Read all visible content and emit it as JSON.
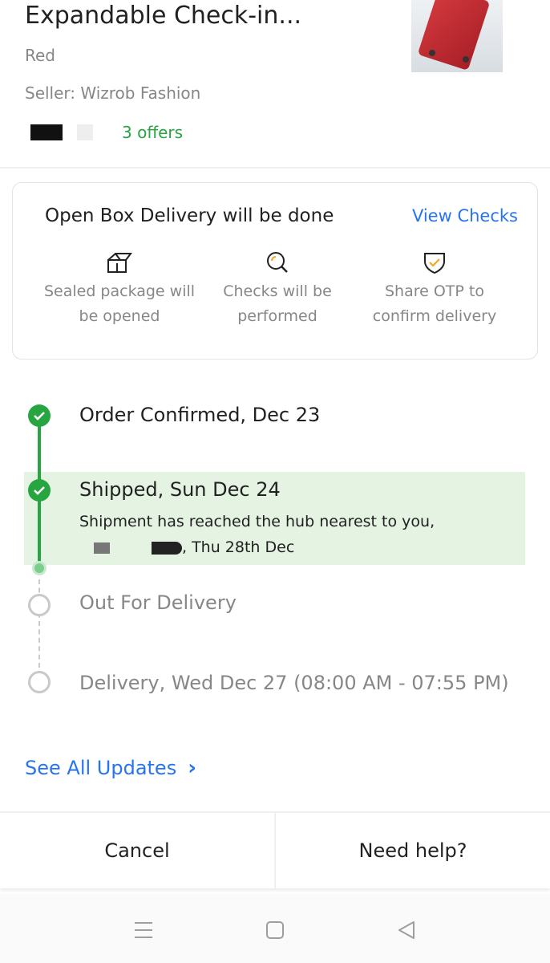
{
  "product": {
    "title": "Expandable Check-in...",
    "color": "Red",
    "seller": "Seller: Wizrob Fashion",
    "offers": "3 offers",
    "image_icon": "suitcase-image"
  },
  "open_box": {
    "title": "Open Box Delivery will be done",
    "link": "View Checks",
    "items": [
      {
        "icon": "box-icon",
        "text": "Sealed package will be opened"
      },
      {
        "icon": "magnifier-icon",
        "text": "Checks will be performed"
      },
      {
        "icon": "shield-check-icon",
        "text": "Share OTP to confirm delivery"
      }
    ]
  },
  "timeline": {
    "steps": [
      {
        "label": "Order Confirmed, Dec 23",
        "status": "done"
      },
      {
        "label": "Shipped, Sun Dec 24",
        "status": "done",
        "detail_line1": "Shipment has reached the hub nearest to you,",
        "detail_line2": ", Thu 28th Dec"
      },
      {
        "label": "Out For Delivery",
        "status": "pending"
      },
      {
        "label": "Delivery, Wed Dec 27 (08:00 AM - 07:55 PM)",
        "status": "pending"
      }
    ]
  },
  "see_all": "See All Updates",
  "actions": {
    "cancel": "Cancel",
    "help": "Need help?"
  },
  "colors": {
    "accent_blue": "#2874f0",
    "success_green": "#26a541",
    "highlight_green": "#e4f3e2",
    "muted_text": "#878787"
  }
}
